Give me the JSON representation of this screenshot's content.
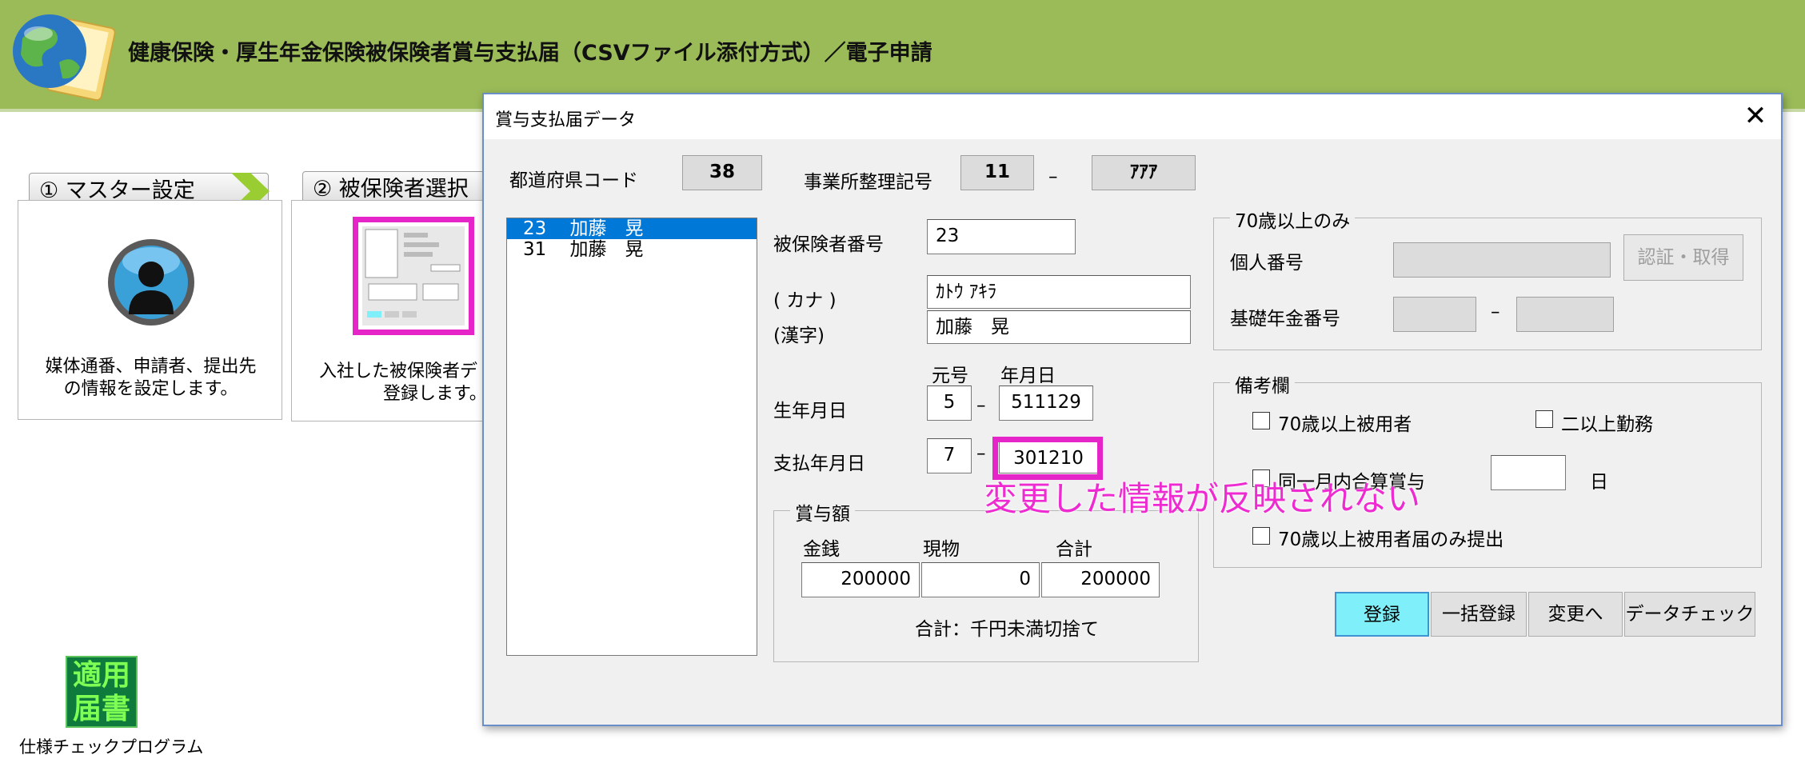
{
  "app": {
    "title": "健康保険・厚生年金保険被保険者賞与支払届（CSVファイル添付方式）／電子申請"
  },
  "steps": [
    {
      "tab_label": "①  マスター設定",
      "description": [
        "媒体通番、申請者、提出先",
        "の情報を設定します。"
      ]
    },
    {
      "tab_label": "②  被保険者選択",
      "description": [
        "入社した被保険者デ",
        "登録します。"
      ]
    }
  ],
  "sidebar_tool": {
    "icon_text": [
      "適用",
      "届書"
    ],
    "label": "仕様チェックプログラム"
  },
  "dialog": {
    "title": "賞与支払届データ",
    "close_symbol": "✕",
    "pref_code_label": "都道府県コード",
    "pref_code": "38",
    "office_label": "事業所整理記号",
    "office_code1": "11",
    "office_dash": "–",
    "office_code2": "ｱｱｱ",
    "list": [
      {
        "num": "23",
        "name": "加藤　晃"
      },
      {
        "num": "31",
        "name": "加藤　晃"
      }
    ],
    "insured_no_label": "被保険者番号",
    "insured_no": "23",
    "kana_label": "( カナ )",
    "kana": "ｶﾄｳ ｱｷﾗ",
    "kanji_label": "(漢字)",
    "kanji": "加藤　晃",
    "era_header": "元号",
    "ymd_header": "年月日",
    "birth_label": "生年月日",
    "birth_era": "5",
    "birth_ymd": "511129",
    "pay_label": "支払年月日",
    "pay_era": "7",
    "pay_ymd": "301210",
    "dash": "–",
    "bonus": {
      "title": "賞与額",
      "cash_label": "金銭",
      "kind_label": "現物",
      "total_label": "合計",
      "cash": "200000",
      "kind": "0",
      "total": "200000",
      "note": "合計：千円未満切捨て"
    },
    "over70": {
      "title": "70歳以上のみ",
      "mynumber_label": "個人番号",
      "auth_button": "認証・取得",
      "pension_label": "基礎年金番号",
      "dash": "–"
    },
    "remarks": {
      "title": "備考欄",
      "chk_over70": "70歳以上被用者",
      "chk_multi": "二以上勤務",
      "chk_same_month": "同一月内合算賞与",
      "day_label": "日",
      "chk_over70_only": "70歳以上被用者届のみ提出"
    },
    "buttons": {
      "register": "登録",
      "bulk_register": "一括登録",
      "change": "変更へ",
      "data_check": "データチェック"
    }
  },
  "annotation": {
    "text": "変更した情報が反映されない",
    "color": "#ee2bd0"
  },
  "colors": {
    "header_green": "#9bbb59",
    "selection_blue": "#0078d7",
    "primary_button": "#7ff0f9"
  }
}
